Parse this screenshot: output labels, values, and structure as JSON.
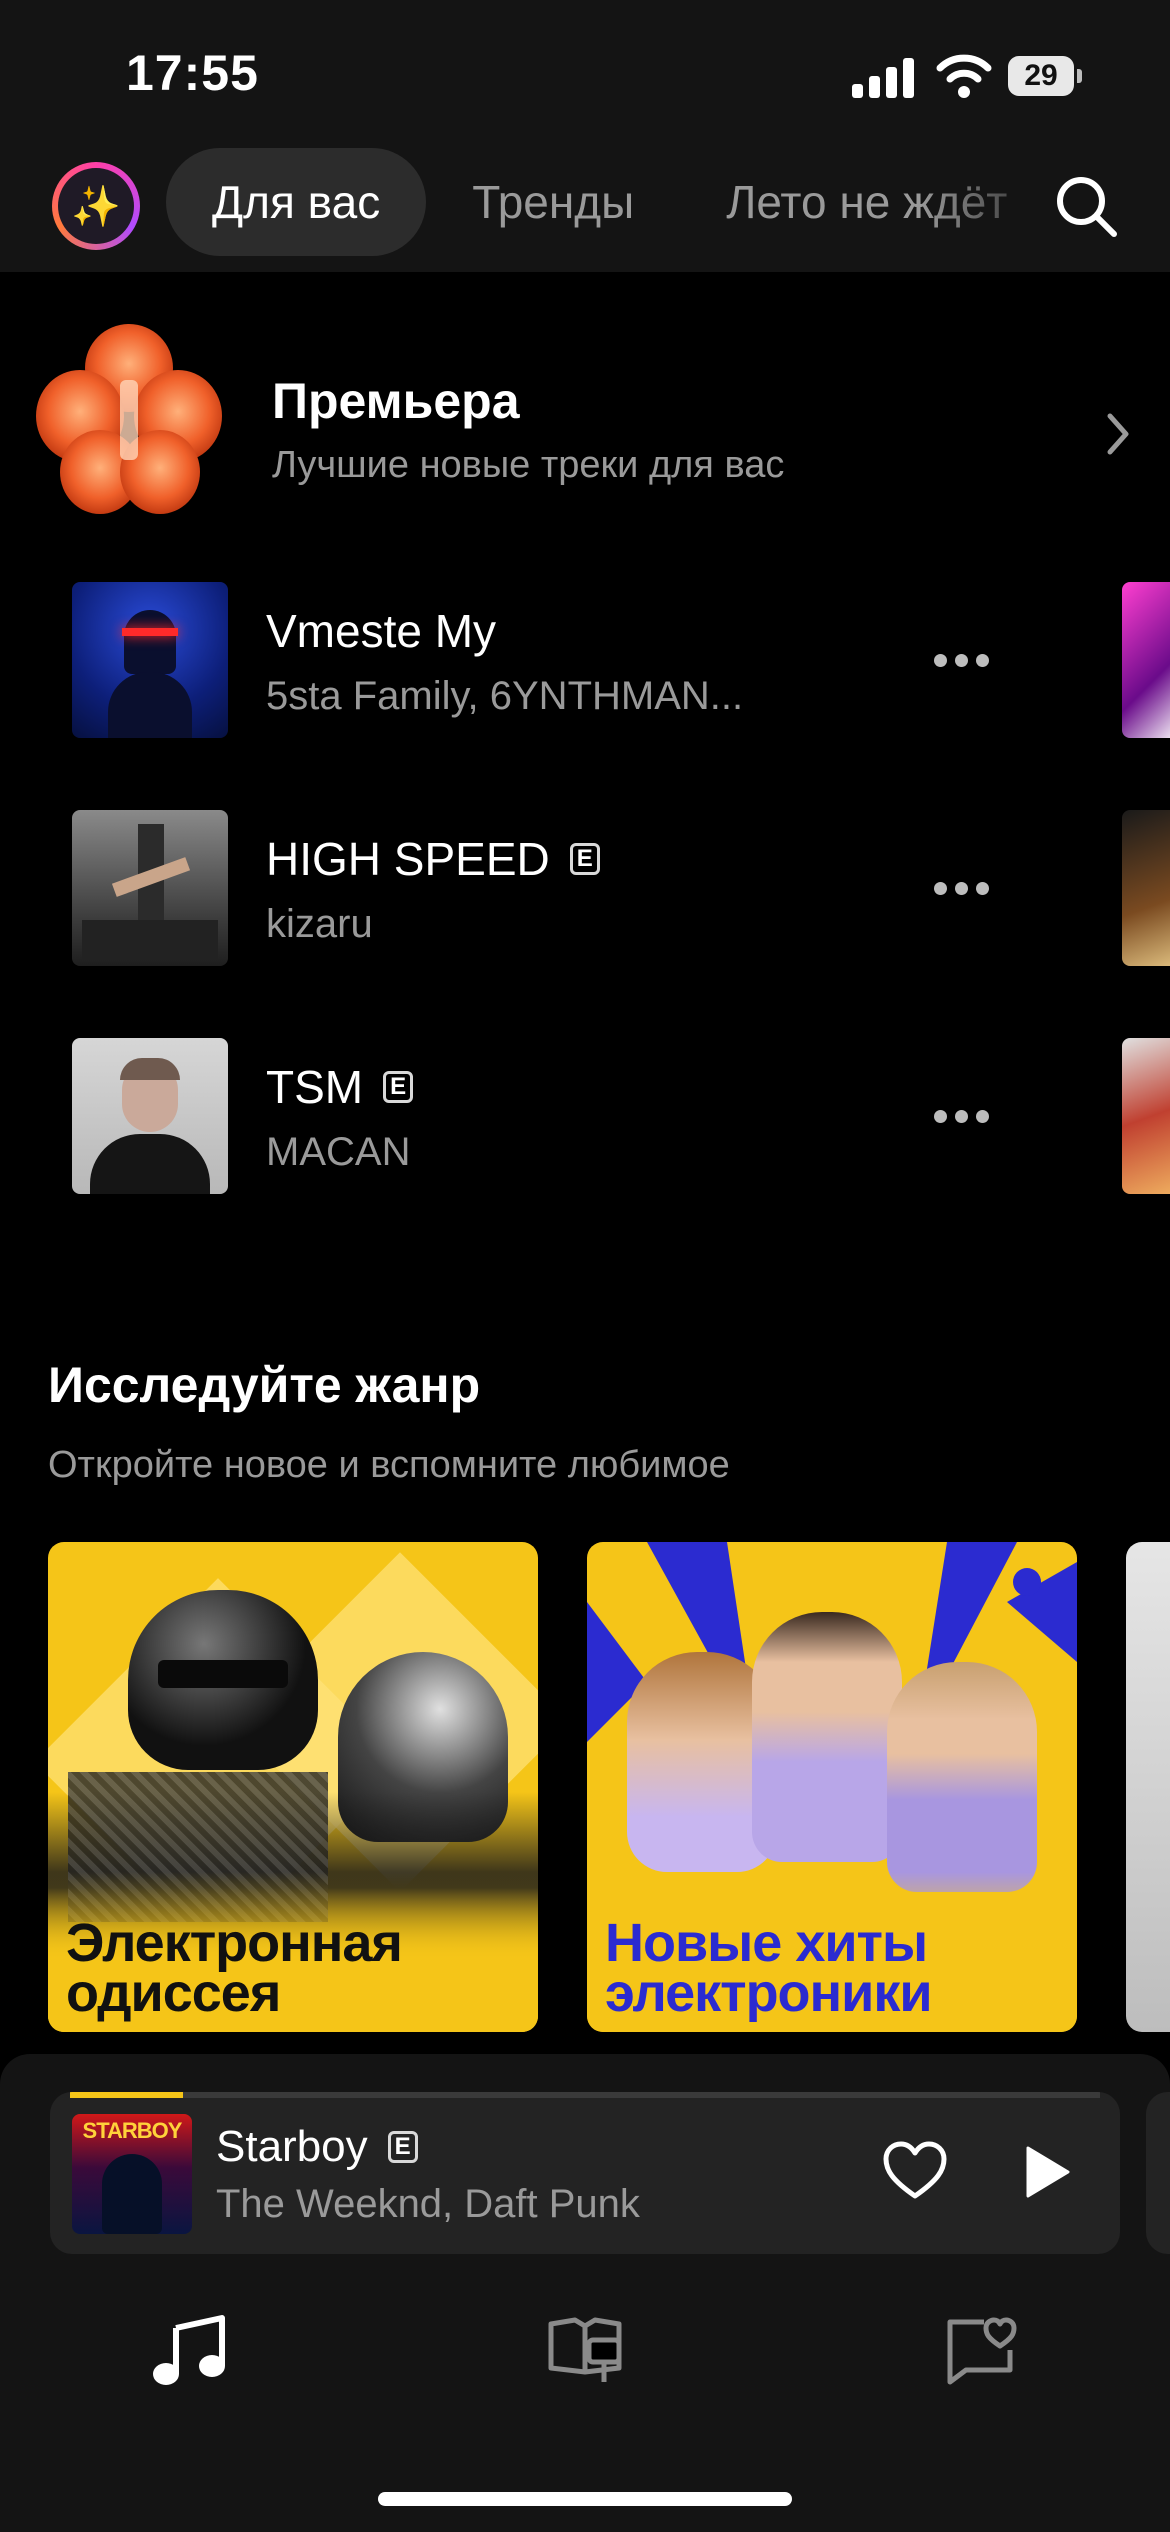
{
  "status_bar": {
    "time": "17:55",
    "battery": "29"
  },
  "tabs": [
    {
      "label": "Для вас",
      "active": true
    },
    {
      "label": "Тренды",
      "active": false
    },
    {
      "label": "Лето не ждёт",
      "active": false
    }
  ],
  "premiere": {
    "title": "Премьера",
    "subtitle": "Лучшие новые треки для вас"
  },
  "tracks": [
    {
      "title": "Vmeste My",
      "artist": "5sta Family, 6YNTHMAN...",
      "explicit": false
    },
    {
      "title": "HIGH SPEED",
      "artist": "kizaru",
      "explicit": true
    },
    {
      "title": "TSM",
      "artist": "MACAN",
      "explicit": true
    }
  ],
  "explicit_badge": "E",
  "genre": {
    "title": "Исследуйте жанр",
    "subtitle": "Откройте новое и вспомните любимое",
    "cards": [
      {
        "label_line1": "Электронная",
        "label_line2": "одиссея"
      },
      {
        "label_line1": "Новые хиты",
        "label_line2": "электроники"
      }
    ]
  },
  "player": {
    "title": "Starboy",
    "artist": "The Weeknd, Daft Punk",
    "explicit": true,
    "progress": 0.11,
    "cover_text": "STARBOY"
  },
  "nav": [
    {
      "icon": "music-note-icon"
    },
    {
      "icon": "library-icon"
    },
    {
      "icon": "favorites-icon"
    }
  ],
  "colors": {
    "accent": "#f5c518",
    "background": "#000000",
    "secondary_text": "#9a9a9a",
    "card_label_dark": "#111111",
    "card_label_blue": "#2b2bd0"
  }
}
